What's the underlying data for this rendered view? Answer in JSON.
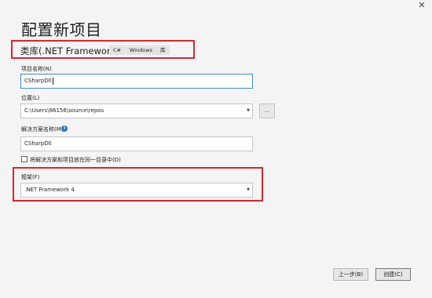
{
  "window": {
    "close_glyph": "✕"
  },
  "page_title": "配置新项目",
  "template": {
    "name": "类库(.NET Framework)",
    "tags": [
      "C#",
      "Windows",
      "库"
    ]
  },
  "project_name": {
    "label": "项目名称(N)",
    "value": "CSharpDll"
  },
  "location": {
    "label": "位置(L)",
    "value": "C:\\Users\\86156\\source\\repos",
    "browse_label": "..."
  },
  "solution_name": {
    "label": "解决方案名称(M)",
    "value": "CSharpDll",
    "info_glyph": "i"
  },
  "same_dir_checkbox": {
    "label": "将解决方案和项目放在同一目录中(D)",
    "checked": false
  },
  "framework": {
    "label": "框架(F)",
    "value": ".NET Framework 4"
  },
  "dropdown_glyph": "▼",
  "buttons": {
    "back": "上一步(B)",
    "create": "创建(C)"
  },
  "colors": {
    "highlight": "#e0242b",
    "focus_border": "#3a8ad8",
    "info": "#1e78c8"
  },
  "icons": [
    "close-icon",
    "info-icon",
    "chevron-down-icon",
    "ellipsis-icon"
  ]
}
